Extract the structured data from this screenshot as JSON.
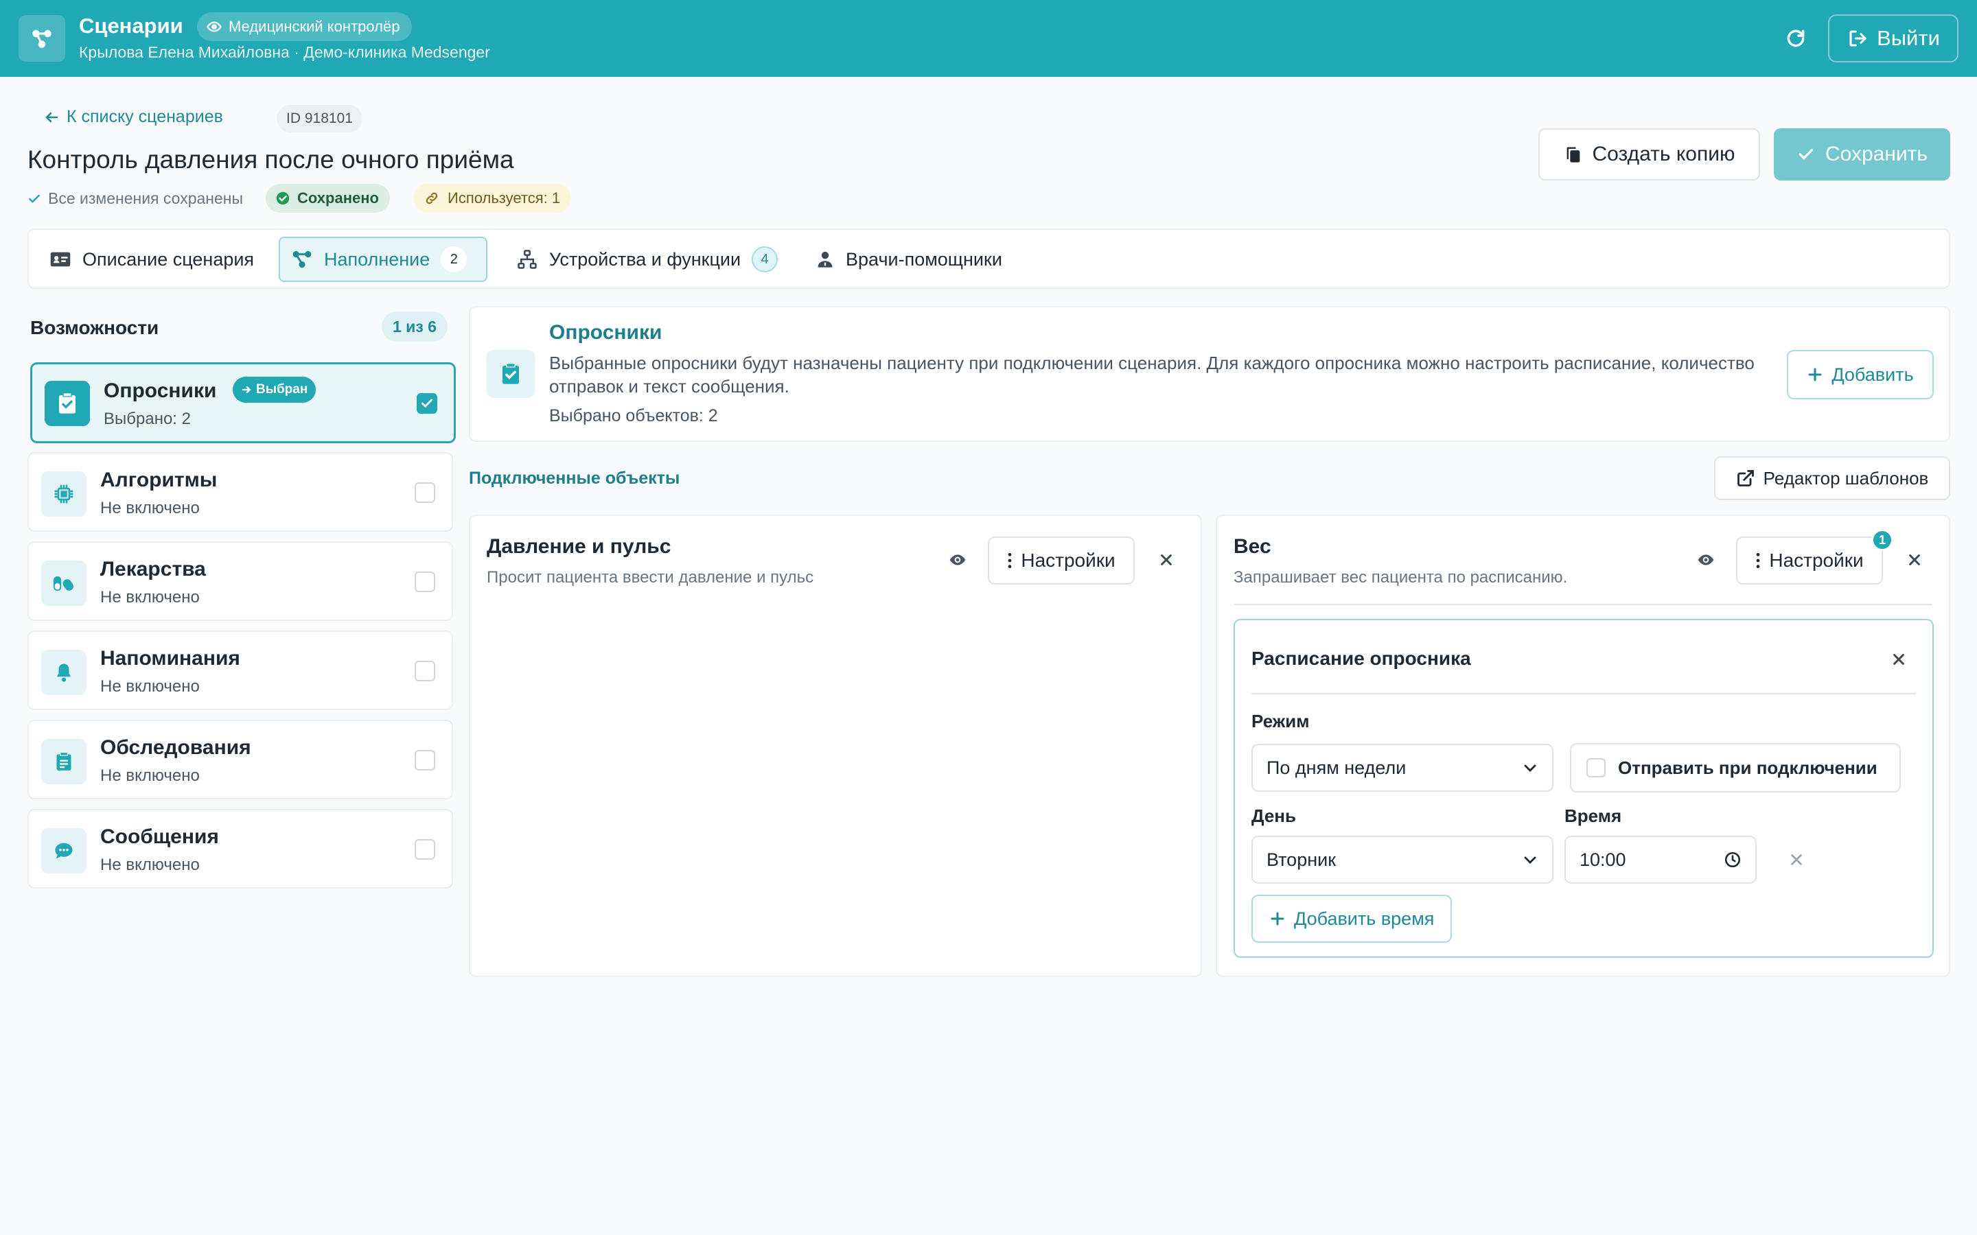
{
  "header": {
    "app_title": "Сценарии",
    "role": "Медицинский контролёр",
    "user_line": "Крылова Елена Михайловна · Демо-клиника Medsenger",
    "logout": "Выйти"
  },
  "page": {
    "back_link": "К списку сценариев",
    "id_badge": "ID 918101",
    "title": "Контроль давления после очного приёма",
    "saved_note": "Все изменения сохранены",
    "saved_badge": "Сохранено",
    "used_badge": "Используется: 1",
    "copy_button": "Создать копию",
    "save_button": "Сохранить"
  },
  "tabs": [
    {
      "label": "Описание сценария"
    },
    {
      "label": "Наполнение",
      "count": "2"
    },
    {
      "label": "Устройства и функции",
      "count": "4"
    },
    {
      "label": "Врачи-помощники"
    }
  ],
  "capabilities": {
    "title": "Возможности",
    "count": "1 из 6",
    "chosen_label": "Выбран",
    "items": [
      {
        "name": "Опросники",
        "sub": "Выбрано: 2",
        "icon": "clipboard-check-icon"
      },
      {
        "name": "Алгоритмы",
        "sub": "Не включено",
        "icon": "chip-icon"
      },
      {
        "name": "Лекарства",
        "sub": "Не включено",
        "icon": "pills-icon"
      },
      {
        "name": "Напоминания",
        "sub": "Не включено",
        "icon": "bell-icon"
      },
      {
        "name": "Обследования",
        "sub": "Не включено",
        "icon": "clipboard-list-icon"
      },
      {
        "name": "Сообщения",
        "sub": "Не включено",
        "icon": "chat-icon"
      }
    ]
  },
  "info": {
    "title": "Опросники",
    "description": "Выбранные опросники будут назначены пациенту при подключении сценария. Для каждого опросника можно настроить расписание, количество отправок и текст сообщения.",
    "selected_count": "Выбрано объектов: 2",
    "add_button": "Добавить"
  },
  "connected": {
    "title": "Подключенные объекты",
    "template_editor": "Редактор шаблонов",
    "objects": [
      {
        "title": "Давление и пульс",
        "desc": "Просит пациента ввести давление и пульс",
        "settings": "Настройки"
      },
      {
        "title": "Вес",
        "desc": "Запрашивает вес пациента по расписанию.",
        "settings": "Настройки",
        "badge": "1"
      }
    ]
  },
  "schedule": {
    "title": "Расписание опросника",
    "mode_label": "Режим",
    "mode_value": "По дням недели",
    "send_on_connect": "Отправить при подключении",
    "day_label": "День",
    "day_value": "Вторник",
    "time_label": "Время",
    "time_value": "10:00",
    "add_time": "Добавить время"
  },
  "colors": {
    "accent": "#20a8b4",
    "accent_dark": "#1e8a96",
    "save_disabled": "#74c6cf"
  }
}
